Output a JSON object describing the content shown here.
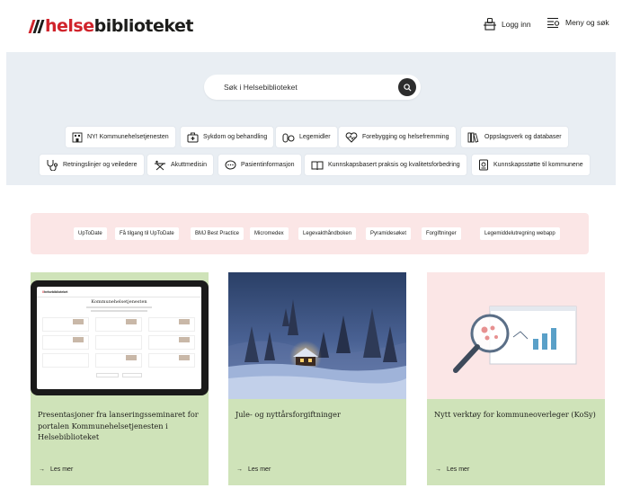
{
  "header": {
    "logo_part1": "helse",
    "logo_part2": "biblioteket",
    "login_label": "Logg inn",
    "menu_label": "Meny og søk"
  },
  "search": {
    "placeholder": "Søk i Helsebiblioteket"
  },
  "topics": [
    {
      "label": "NY! Kommunehelsetjenesten",
      "icon": "building-icon"
    },
    {
      "label": "Sykdom og behandling",
      "icon": "medkit-icon"
    },
    {
      "label": "Legemidler",
      "icon": "pills-icon"
    },
    {
      "label": "Forebygging og helsefremming",
      "icon": "heartbeat-icon"
    },
    {
      "label": "Oppslagsverk og databaser",
      "icon": "books-icon"
    },
    {
      "label": "Retningslinjer og veiledere",
      "icon": "stethoscope-icon"
    },
    {
      "label": "Akuttmedisin",
      "icon": "stretcher-icon"
    },
    {
      "label": "Pasientinformasjon",
      "icon": "chat-icon"
    },
    {
      "label": "Kunnskapsbasert praksis og kvalitetsforbedring",
      "icon": "book-open-icon"
    },
    {
      "label": "Kunnskapsstøtte til kommunene",
      "icon": "document-icon"
    }
  ],
  "quick_links": [
    "UpToDate",
    "Få tilgang til UpToDate",
    "BMJ Best Practice",
    "Micromedex",
    "Legevakthåndboken",
    "Pyramidesøket",
    "Forgiftninger",
    "Legemiddelutregning webapp"
  ],
  "cards": [
    {
      "title": "Presentasjoner fra lanseringsseminaret for portalen Kommunehelsetjenesten i Helsebiblioteket",
      "link": "Les mer"
    },
    {
      "title": "Jule- og nyttårsforgiftninger",
      "link": "Les mer"
    },
    {
      "title": "Nytt verktøy for kommuneoverleger (KoSy)",
      "link": "Les mer"
    }
  ],
  "tablet_screen": {
    "logo": "helsebiblioteket",
    "heading": "Kommunehelsetjenesten"
  },
  "colors": {
    "brand_red": "#d0232b",
    "hero_bg": "#e9eef3",
    "quick_bg": "#fbe6e6",
    "card_green": "#cfe3b9",
    "card_pink": "#fbe6e6"
  }
}
